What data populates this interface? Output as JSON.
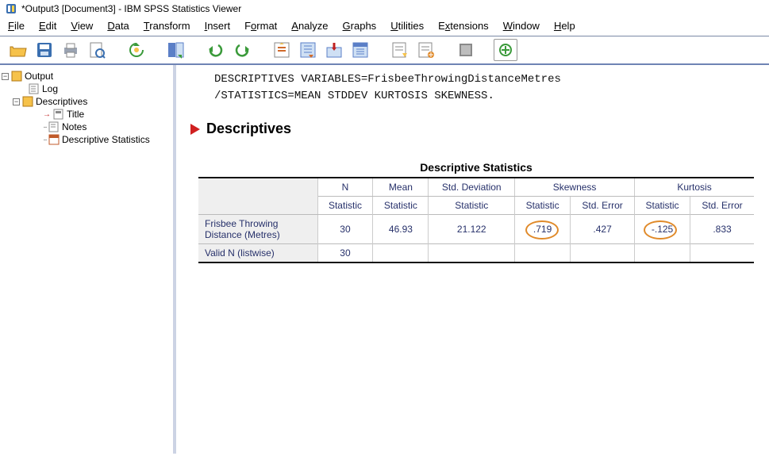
{
  "window": {
    "title": "*Output3 [Document3] - IBM SPSS Statistics Viewer"
  },
  "menus": {
    "file": "File",
    "edit": "Edit",
    "view": "View",
    "data": "Data",
    "transform": "Transform",
    "insert": "Insert",
    "format": "Format",
    "analyze": "Analyze",
    "graphs": "Graphs",
    "utilities": "Utilities",
    "extensions": "Extensions",
    "window": "Window",
    "help": "Help"
  },
  "tree": {
    "root": "Output",
    "node1": "Log",
    "node2": "Descriptives",
    "node2a": "Title",
    "node2b": "Notes",
    "node2c": "Descriptive Statistics"
  },
  "syntax": {
    "line1": "DESCRIPTIVES VARIABLES=FrisbeeThrowingDistanceMetres",
    "line2": "  /STATISTICS=MEAN STDDEV KURTOSIS SKEWNESS."
  },
  "section": {
    "title": "Descriptives"
  },
  "table": {
    "title": "Descriptive Statistics",
    "head": {
      "blank": "",
      "n": "N",
      "mean": "Mean",
      "stddev": "Std. Deviation",
      "skew": "Skewness",
      "kurt": "Kurtosis",
      "stat": "Statistic",
      "stderr": "Std. Error"
    },
    "rows": [
      {
        "label": "Frisbee Throwing Distance (Metres)",
        "n": "30",
        "mean": "46.93",
        "stddev": "21.122",
        "skew_stat": ".719",
        "skew_se": ".427",
        "kurt_stat": "-.125",
        "kurt_se": ".833"
      },
      {
        "label": "Valid N (listwise)",
        "n": "30",
        "mean": "",
        "stddev": "",
        "skew_stat": "",
        "skew_se": "",
        "kurt_stat": "",
        "kurt_se": ""
      }
    ]
  }
}
